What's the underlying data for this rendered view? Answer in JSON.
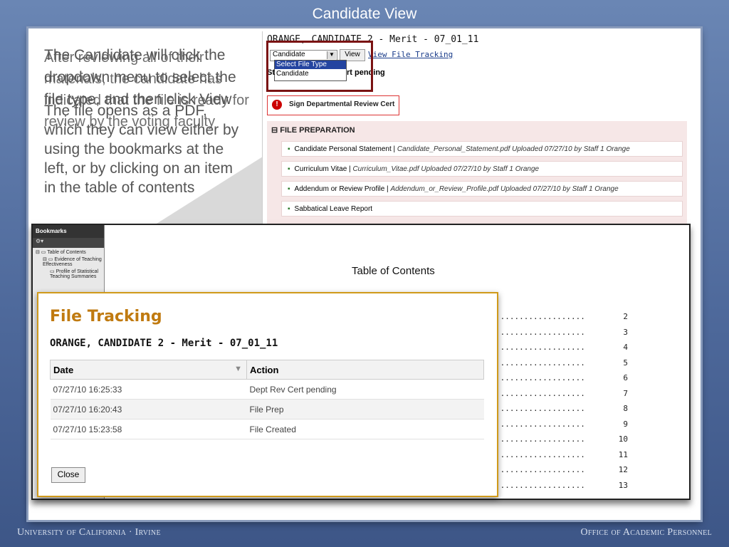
{
  "slide": {
    "title": "Candidate View",
    "overlay_line1": "The Candidate will click the dropdown menu to select the file type, and then click View",
    "overlay_line2": "After reviewing all of their materials, the candidate has indicated that the file is ready for review by the voting faculty",
    "overlay_line3": "The file opens as a PDF, which they can view either by using the bookmarks at the left, or by clicking on an item in the table of contents",
    "footer_left": "University of California · Irvine",
    "footer_right": "Office of Academic Personnel"
  },
  "app": {
    "candidate_title": "ORANGE, CANDIDATE 2 - Merit - 07_01_11",
    "select_value": "Candidate",
    "view_button": "View",
    "view_tracking_link": "View File Tracking",
    "dropdown_options": [
      "Select File Type",
      "Candidate"
    ],
    "status_prefix": "St",
    "status_text": "rt pending",
    "alert_label": "Sign Departmental Review Cert",
    "section_title": "FILE PREPARATION",
    "rows": [
      {
        "label": "Candidate Personal Statement",
        "file": "Candidate_Personal_Statement.pdf Uploaded 07/27/10 by Staff 1 Orange"
      },
      {
        "label": "Curriculum Vitae",
        "file": "Curriculum_Vitae.pdf Uploaded 07/27/10 by Staff 1 Orange"
      },
      {
        "label": "Addendum or Review Profile",
        "file": "Addendum_or_Review_Profile.pdf Uploaded 07/27/10 by Staff 1 Orange"
      },
      {
        "label": "Sabbatical Leave Report",
        "file": ""
      }
    ]
  },
  "pdf": {
    "bookmarks_title": "Bookmarks",
    "bookmarks": [
      "Table of Contents",
      "Evidence of Teaching Effectiveness",
      "Profile of Statistical Teaching Summaries"
    ],
    "toc_title": "Table of Contents",
    "toc_dots": "...................",
    "toc_pages": [
      "2",
      "3",
      "4",
      "5",
      "6",
      "7",
      "8",
      "9",
      "10",
      "11",
      "12",
      "13"
    ]
  },
  "file_tracking": {
    "title": "File Tracking",
    "subtitle": "ORANGE, CANDIDATE 2 - Merit - 07_01_11",
    "col_date": "Date",
    "col_action": "Action",
    "rows": [
      {
        "date": "07/27/10 16:25:33",
        "action": "Dept Rev Cert pending"
      },
      {
        "date": "07/27/10 16:20:43",
        "action": "File Prep"
      },
      {
        "date": "07/27/10 15:23:58",
        "action": "File Created"
      }
    ],
    "close_button": "Close"
  },
  "colors": {
    "accent": "#c07a10",
    "highlight_box": "#7a1212",
    "background": "#5a76a8"
  }
}
